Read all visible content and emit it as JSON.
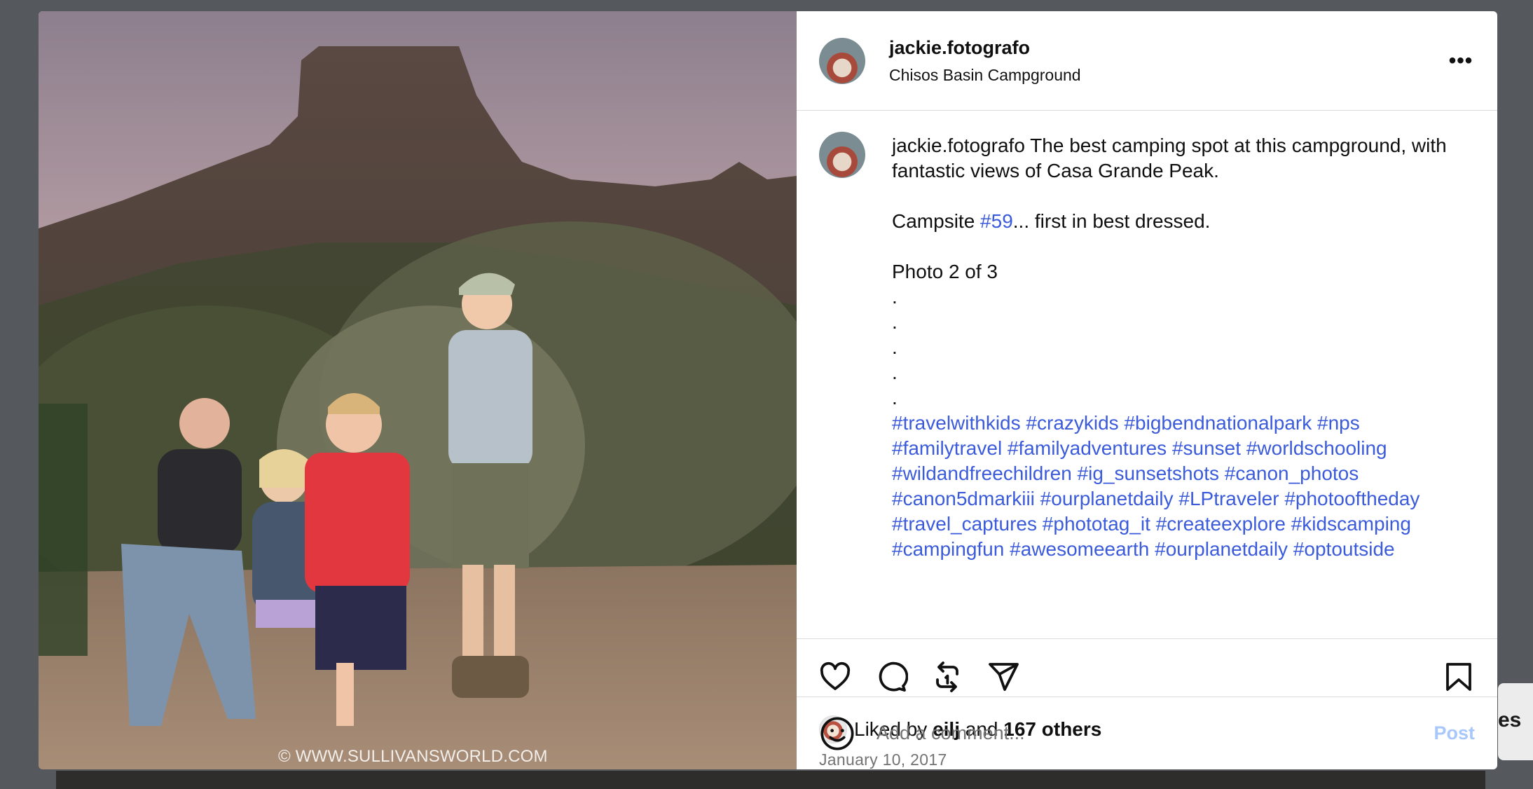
{
  "post": {
    "username": "jackie.fotografo",
    "location": "Chisos Basin Campground",
    "more_label": "•••",
    "watermark": "© WWW.SULLIVANSWORLD.COM"
  },
  "caption": {
    "username": "jackie.fotografo",
    "line1": " The best camping spot at this campground, with fantastic views of Casa Grande Peak.",
    "campsite_prefix": "Campsite ",
    "campsite_tag": "#59",
    "campsite_suffix": "... first in best dressed.",
    "photo_line": "Photo 2 of 3",
    "dots": [
      ".",
      ".",
      ".",
      ".",
      "."
    ],
    "hashtags": [
      "#travelwithkids",
      "#crazykids",
      "#bigbendnationalpark",
      "#nps",
      "#familytravel",
      "#familyadventures",
      "#sunset",
      "#worldschooling",
      "#wildandfreechildren",
      "#ig_sunsetshots",
      "#canon_photos",
      "#canon5dmarkiii",
      "#ourplanetdaily",
      "#LPtraveler",
      "#photooftheday",
      "#travel_captures",
      "#phototag_it",
      "#createexplore",
      "#kidscamping",
      "#campingfun",
      "#awesomeearth",
      "#ourplanetdaily",
      "#optoutside"
    ]
  },
  "actions": {
    "like_icon": "heart-icon",
    "comment_icon": "comment-icon",
    "repost_icon": "repost-icon",
    "share_icon": "share-icon",
    "save_icon": "bookmark-icon"
  },
  "likes": {
    "prefix": "Liked by ",
    "user": "eilj",
    "middle": " and ",
    "others": "167 others"
  },
  "date": "January 10, 2017",
  "comment_box": {
    "placeholder": "Add a comment...",
    "post_label": "Post"
  },
  "background": {
    "partial_text": "es"
  },
  "colors": {
    "hashtag": "#3b5bdb",
    "post_button": "#a8c7fa",
    "backdrop": "#55585d"
  }
}
